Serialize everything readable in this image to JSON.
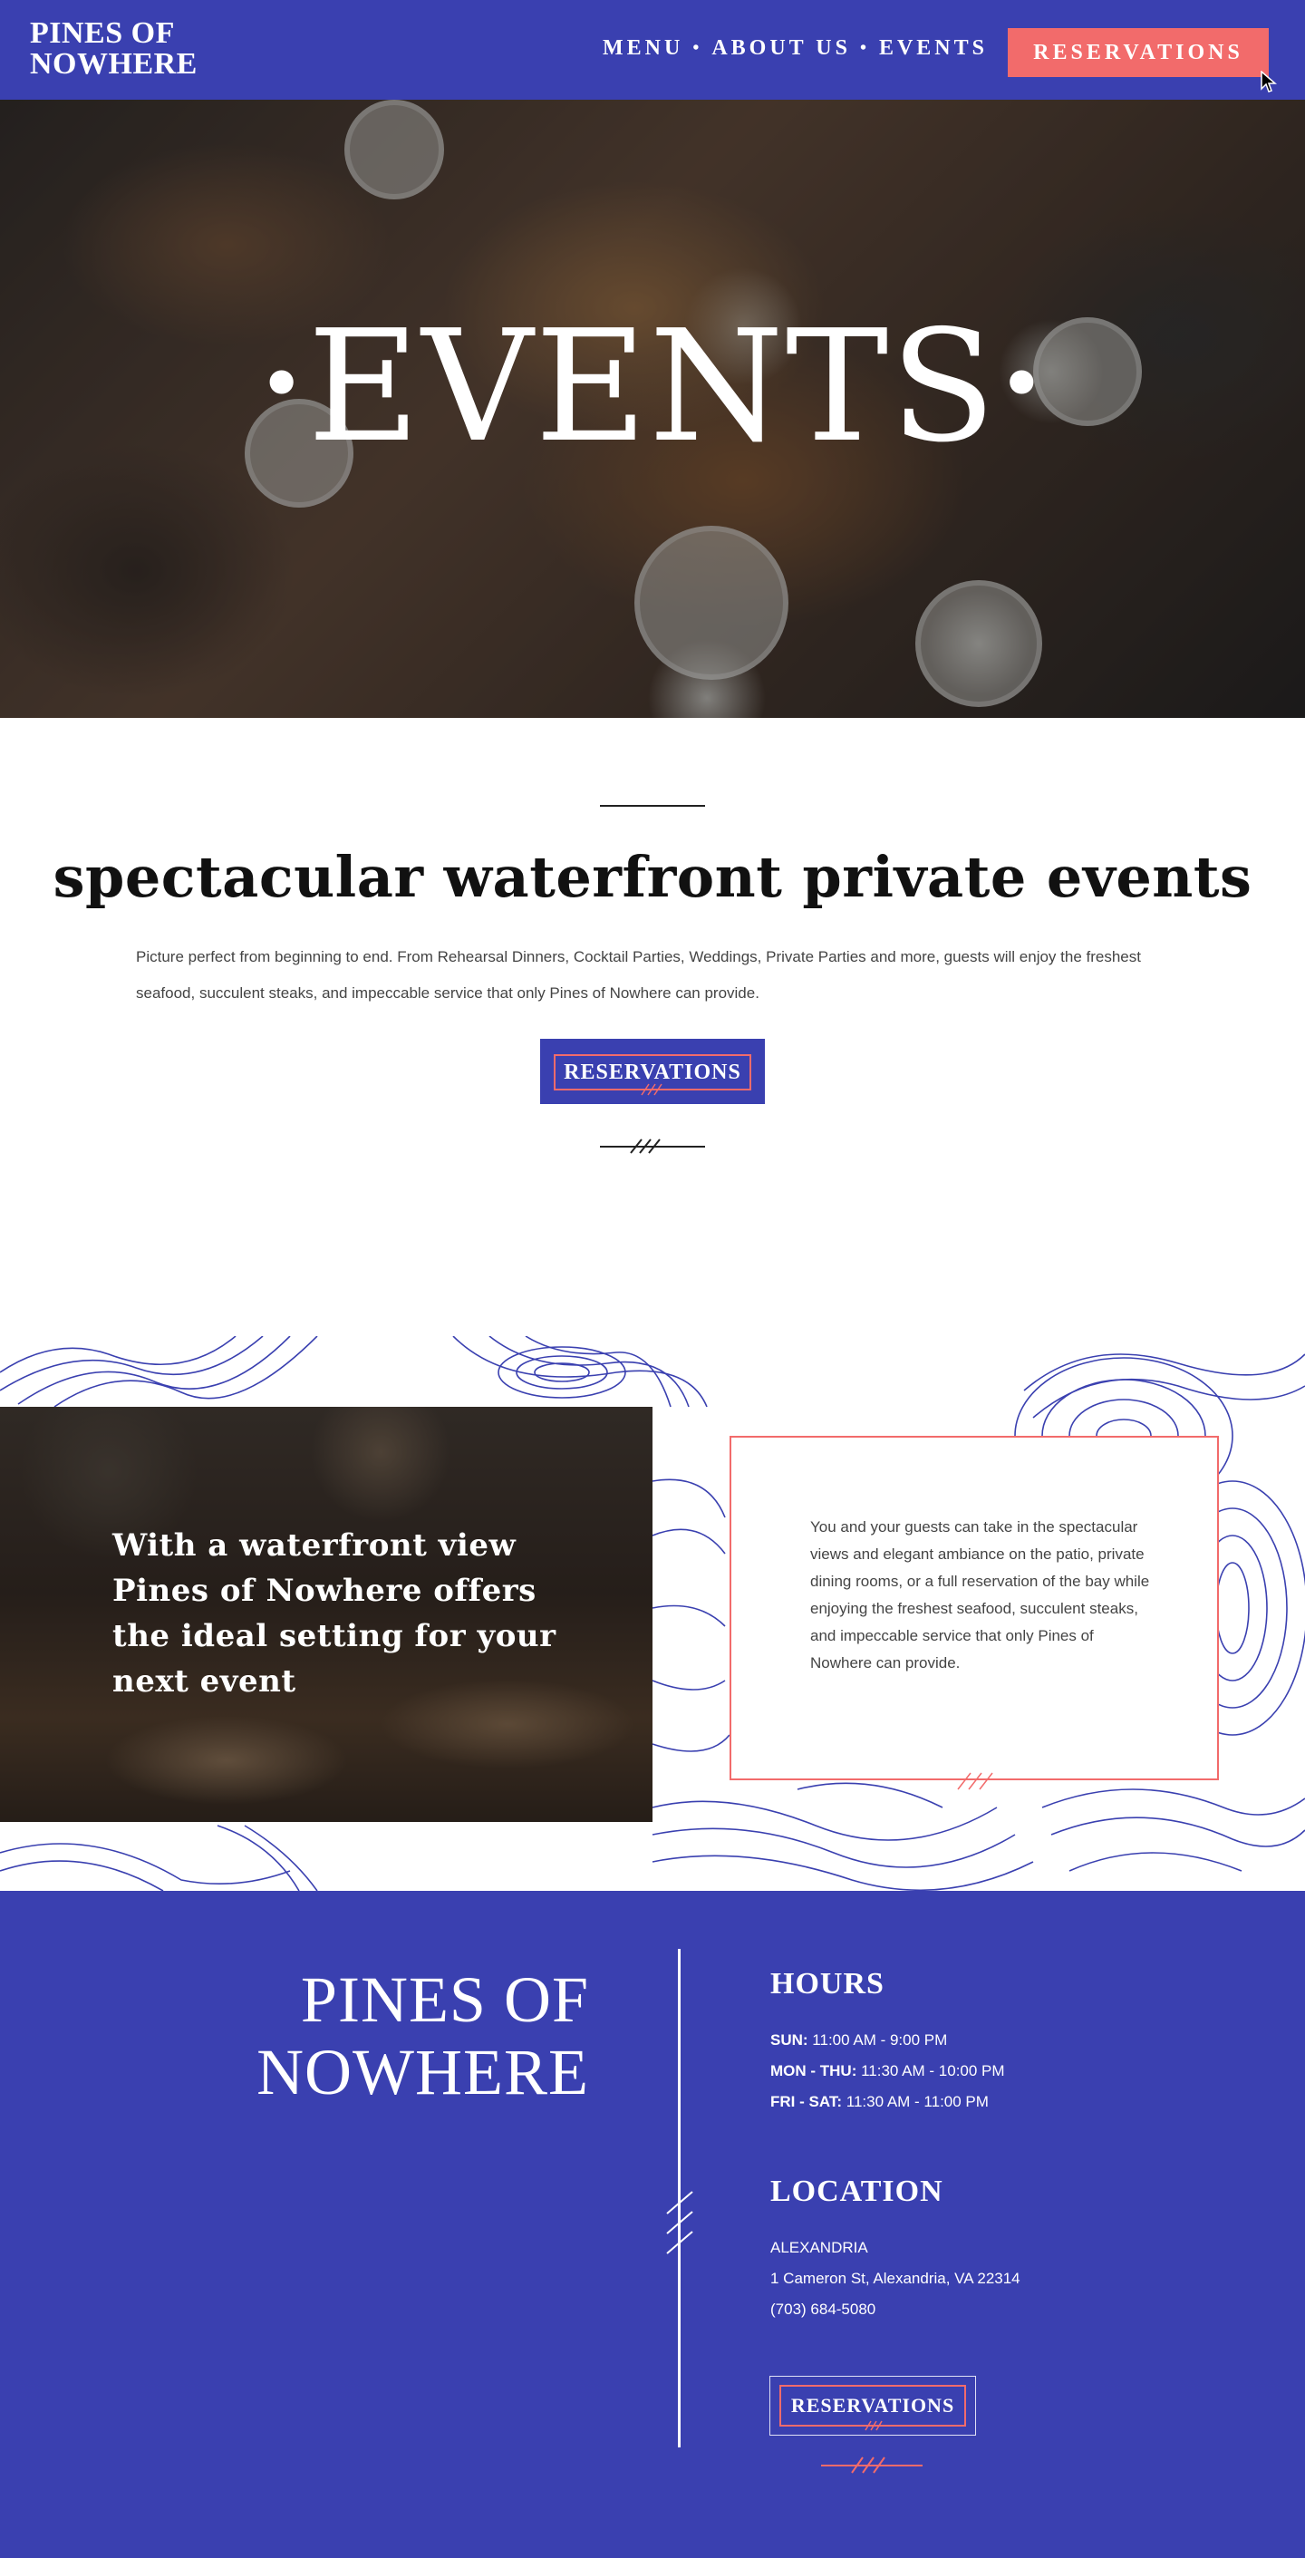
{
  "header": {
    "logo_line1": "PINES OF",
    "logo_line2": "NOWHERE",
    "nav": [
      "MENU",
      "ABOUT US",
      "EVENTS"
    ],
    "nav_separator": "•",
    "reservations_label": "RESERVATIONS"
  },
  "hero": {
    "title": "EVENTS",
    "bullet": "•"
  },
  "intro": {
    "title": "spectacular waterfront private events",
    "text": "Picture perfect from beginning to end. From Rehearsal Dinners, Cocktail Parties, Weddings, Private Parties and more, guests will enjoy the freshest seafood, succulent steaks, and impeccable service that only Pines of Nowhere can provide.",
    "button_label": "RESERVATIONS"
  },
  "feature": {
    "photo_caption": "With a waterfront view Pines of Nowhere offers the ideal setting for your next event",
    "card_text": "You and your guests can take in the spectacular views and elegant ambiance on the patio, private dining rooms, or a full reservation of the bay while enjoying the freshest seafood, succulent steaks, and impeccable service that only Pines of Nowhere can provide."
  },
  "footer": {
    "brand_line1": "PINES OF",
    "brand_line2": "NOWHERE",
    "hours_heading": "HOURS",
    "hours": [
      {
        "day": "SUN:",
        "time": "11:00 AM - 9:00 PM"
      },
      {
        "day": "MON - THU:",
        "time": "11:30 AM - 10:00 PM"
      },
      {
        "day": "FRI - SAT:",
        "time": "11:30 AM - 11:00 PM"
      }
    ],
    "location_heading": "LOCATION",
    "city": "ALEXANDRIA",
    "address": "1 Cameron St, Alexandria, VA 22314",
    "phone": "(703) 684-5080",
    "button_label": "RESERVATIONS"
  },
  "colors": {
    "brand_blue": "#3a40b0",
    "accent_coral": "#f26b6b"
  }
}
